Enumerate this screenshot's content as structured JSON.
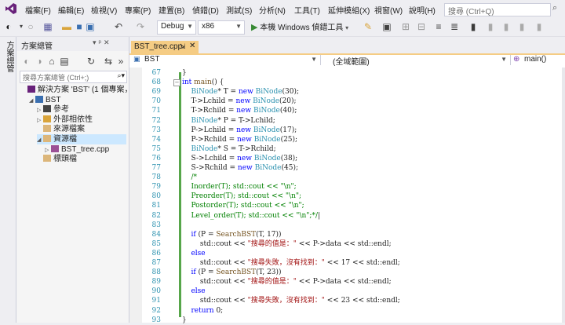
{
  "menu": {
    "items": [
      "檔案(F)",
      "編輯(E)",
      "檢視(V)",
      "專案(P)",
      "建置(B)",
      "偵錯(D)",
      "測試(S)",
      "分析(N)",
      "工具(T)",
      "延伸模組(X)",
      "視窗(W)",
      "說明(H)"
    ],
    "search_placeholder": "搜尋 (Ctrl+Q)"
  },
  "toolbar": {
    "config": "Debug",
    "platform": "x86",
    "run_label": "本機 Windows 偵錯工具"
  },
  "left_strip": {
    "label": "方案總管"
  },
  "solution_explorer": {
    "title": "方案總管",
    "search_placeholder": "搜尋方案總管 (Ctrl+;)",
    "items": [
      {
        "label": "解決方案 'BST' (1 個專案，共 1",
        "indent": 0,
        "expander": "",
        "icon": "solution-icon"
      },
      {
        "label": "BST",
        "indent": 1,
        "expander": "◢",
        "icon": "project-icon"
      },
      {
        "label": "參考",
        "indent": 2,
        "expander": "▷",
        "icon": "references-icon"
      },
      {
        "label": "外部相依性",
        "indent": 2,
        "expander": "▷",
        "icon": "external-dependencies-icon"
      },
      {
        "label": "來源檔案",
        "indent": 2,
        "expander": "",
        "icon": "folder-icon"
      },
      {
        "label": "資源檔",
        "indent": 2,
        "expander": "◢",
        "icon": "folder-icon"
      },
      {
        "label": "BST_tree.cpp",
        "indent": 3,
        "expander": "▷",
        "icon": "cpp-file-icon"
      },
      {
        "label": "標頭檔",
        "indent": 2,
        "expander": "",
        "icon": "folder-icon"
      }
    ]
  },
  "editor": {
    "tab_label": "BST_tree.cpp",
    "nav_scope": "BST",
    "nav_global": "(全域範圍)",
    "nav_function": "main()",
    "lines": [
      {
        "n": "67",
        "fold": "",
        "html": "<span>}</span>"
      },
      {
        "n": "68",
        "fold": "⊟",
        "html": "<span class='kw'>int</span> <span class='fn'>main</span>() {"
      },
      {
        "n": "69",
        "fold": "",
        "html": "    <span class='ty'>BiNode</span>* T = <span class='kw'>new</span> <span class='ty'>BiNode</span>(30);"
      },
      {
        "n": "70",
        "fold": "",
        "html": "    T-&gt;Lchild = <span class='kw'>new</span> <span class='ty'>BiNode</span>(20);"
      },
      {
        "n": "71",
        "fold": "",
        "html": "    T-&gt;Rchild = <span class='kw'>new</span> <span class='ty'>BiNode</span>(40);"
      },
      {
        "n": "72",
        "fold": "",
        "html": "    <span class='ty'>BiNode</span>* P = T-&gt;Lchild;"
      },
      {
        "n": "73",
        "fold": "",
        "html": "    P-&gt;Lchild = <span class='kw'>new</span> <span class='ty'>BiNode</span>(17);"
      },
      {
        "n": "74",
        "fold": "",
        "html": "    P-&gt;Rchild = <span class='kw'>new</span> <span class='ty'>BiNode</span>(25);"
      },
      {
        "n": "75",
        "fold": "",
        "html": "    <span class='ty'>BiNode</span>* S = T-&gt;Rchild;"
      },
      {
        "n": "76",
        "fold": "",
        "html": "    S-&gt;Lchild = <span class='kw'>new</span> <span class='ty'>BiNode</span>(38);"
      },
      {
        "n": "77",
        "fold": "",
        "html": "    S-&gt;Rchild = <span class='kw'>new</span> <span class='ty'>BiNode</span>(45);"
      },
      {
        "n": "78",
        "fold": "",
        "html": "    <span class='cm'>/*</span>"
      },
      {
        "n": "79",
        "fold": "",
        "html": "    <span class='cm'>Inorder(T); std::cout &lt;&lt; \"\\n\";</span>"
      },
      {
        "n": "80",
        "fold": "",
        "html": "    <span class='cm'>Preorder(T); std::cout &lt;&lt; \"\\n\";</span>"
      },
      {
        "n": "81",
        "fold": "",
        "html": "    <span class='cm'>Postorder(T); std::cout &lt;&lt; \"\\n\";</span>"
      },
      {
        "n": "82",
        "fold": "",
        "html": "    <span class='cm'>Level_order(T); std::cout &lt;&lt; \"\\n\";*/</span>|"
      },
      {
        "n": "83",
        "fold": "",
        "html": ""
      },
      {
        "n": "84",
        "fold": "",
        "html": "    <span class='kw'>if</span> (P = <span class='fn'>SearchBST</span>(T, 17))"
      },
      {
        "n": "85",
        "fold": "",
        "html": "        std::cout &lt;&lt; <span class='str'>\"搜尋的值是：\"</span> &lt;&lt; P-&gt;data &lt;&lt; std::endl;"
      },
      {
        "n": "86",
        "fold": "",
        "html": "    <span class='kw'>else</span>"
      },
      {
        "n": "87",
        "fold": "",
        "html": "        std::cout &lt;&lt; <span class='str'>\"搜尋失敗，沒有找到：\"</span> &lt;&lt; 17 &lt;&lt; std::endl;"
      },
      {
        "n": "88",
        "fold": "",
        "html": "    <span class='kw'>if</span> (P = <span class='fn'>SearchBST</span>(T, 23))"
      },
      {
        "n": "89",
        "fold": "",
        "html": "        std::cout &lt;&lt; <span class='str'>\"搜尋的值是：\"</span> &lt;&lt; P-&gt;data &lt;&lt; std::endl;"
      },
      {
        "n": "90",
        "fold": "",
        "html": "    <span class='kw'>else</span>"
      },
      {
        "n": "91",
        "fold": "",
        "html": "        std::cout &lt;&lt; <span class='str'>\"搜尋失敗，沒有找到：\"</span> &lt;&lt; 23 &lt;&lt; std::endl;"
      },
      {
        "n": "92",
        "fold": "",
        "html": "    <span class='kw'>return</span> 0;"
      },
      {
        "n": "93",
        "fold": "",
        "html": "}"
      }
    ]
  }
}
